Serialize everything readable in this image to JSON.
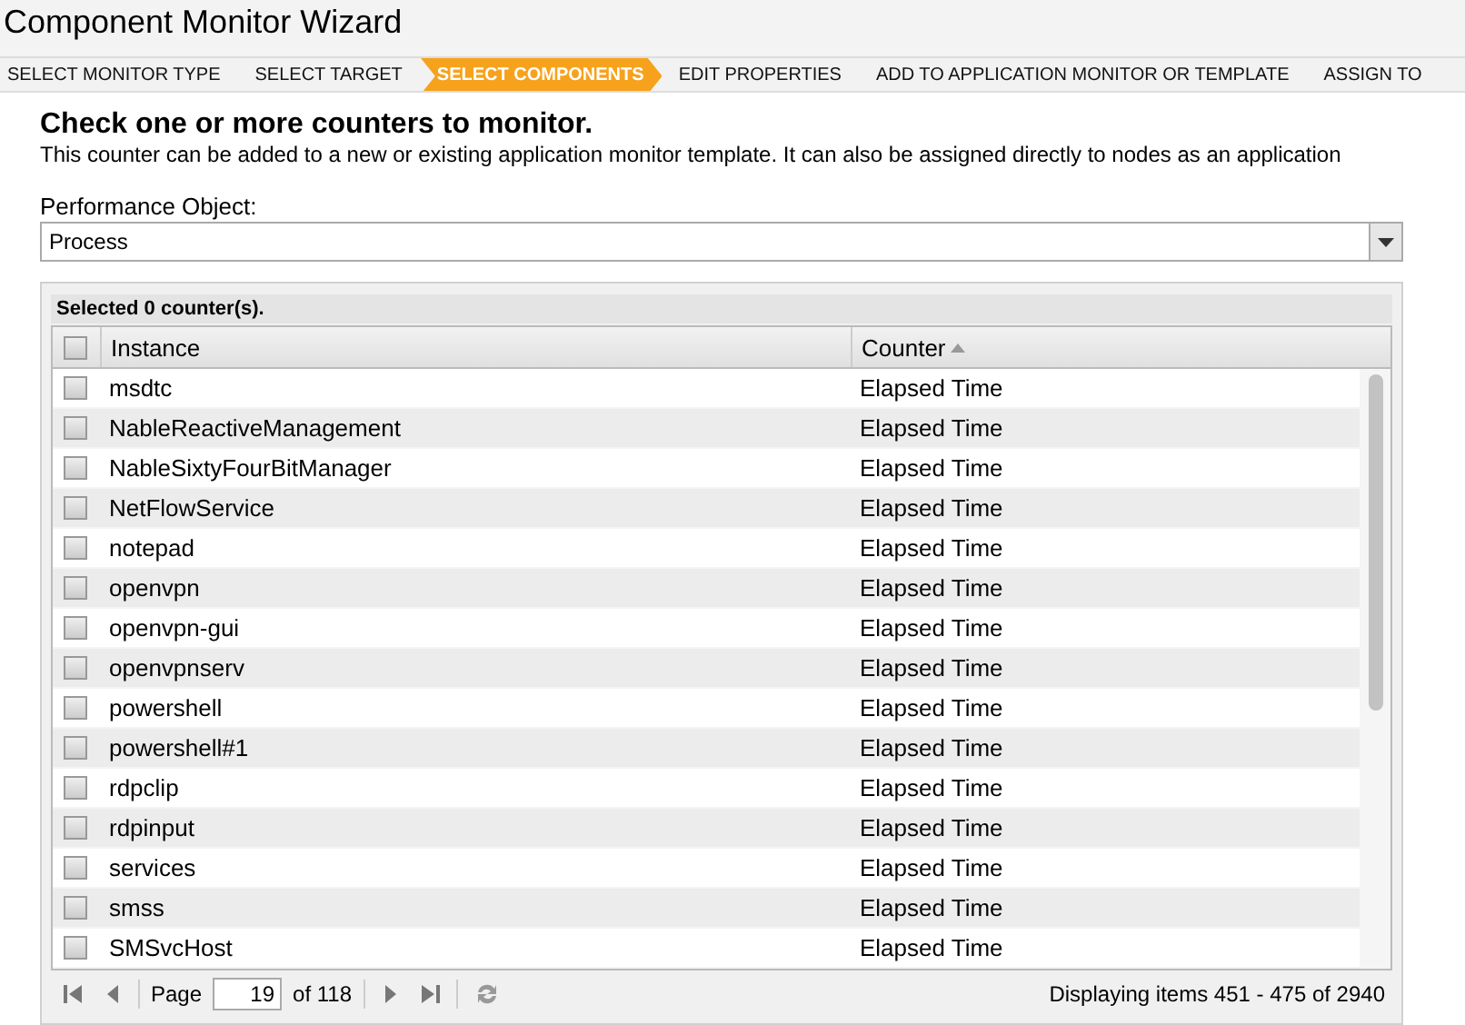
{
  "window": {
    "title": "Component Monitor Wizard"
  },
  "steps": [
    {
      "label": "SELECT MONITOR TYPE",
      "selected": false
    },
    {
      "label": "SELECT TARGET",
      "selected": false
    },
    {
      "label": "SELECT COMPONENTS",
      "selected": true
    },
    {
      "label": "EDIT PROPERTIES",
      "selected": false
    },
    {
      "label": "ADD TO APPLICATION MONITOR OR TEMPLATE",
      "selected": false
    },
    {
      "label": "ASSIGN TO",
      "selected": false
    }
  ],
  "heading": "Check one or more counters to monitor.",
  "description": "This counter can be added to a new or existing application monitor template. It can also be assigned directly to nodes as an application",
  "performance_object": {
    "label": "Performance Object:",
    "value": "Process"
  },
  "grid": {
    "selection_summary": "Selected 0 counter(s).",
    "select_all_checked": false,
    "columns": [
      {
        "label": "Instance",
        "sorted": false
      },
      {
        "label": "Counter",
        "sorted": true
      }
    ],
    "rows": [
      {
        "instance": "msdtc",
        "counter": "Elapsed Time",
        "checked": false
      },
      {
        "instance": "NableReactiveManagement",
        "counter": "Elapsed Time",
        "checked": false
      },
      {
        "instance": "NableSixtyFourBitManager",
        "counter": "Elapsed Time",
        "checked": false
      },
      {
        "instance": "NetFlowService",
        "counter": "Elapsed Time",
        "checked": false
      },
      {
        "instance": "notepad",
        "counter": "Elapsed Time",
        "checked": false
      },
      {
        "instance": "openvpn",
        "counter": "Elapsed Time",
        "checked": false
      },
      {
        "instance": "openvpn-gui",
        "counter": "Elapsed Time",
        "checked": false
      },
      {
        "instance": "openvpnserv",
        "counter": "Elapsed Time",
        "checked": false
      },
      {
        "instance": "powershell",
        "counter": "Elapsed Time",
        "checked": false
      },
      {
        "instance": "powershell#1",
        "counter": "Elapsed Time",
        "checked": false
      },
      {
        "instance": "rdpclip",
        "counter": "Elapsed Time",
        "checked": false
      },
      {
        "instance": "rdpinput",
        "counter": "Elapsed Time",
        "checked": false
      },
      {
        "instance": "services",
        "counter": "Elapsed Time",
        "checked": false
      },
      {
        "instance": "smss",
        "counter": "Elapsed Time",
        "checked": false
      },
      {
        "instance": "SMSvcHost",
        "counter": "Elapsed Time",
        "checked": false
      }
    ],
    "pager": {
      "page_label": "Page",
      "page": "19",
      "of_label": "of 118",
      "summary": "Displaying items 451 - 475 of 2940"
    }
  }
}
